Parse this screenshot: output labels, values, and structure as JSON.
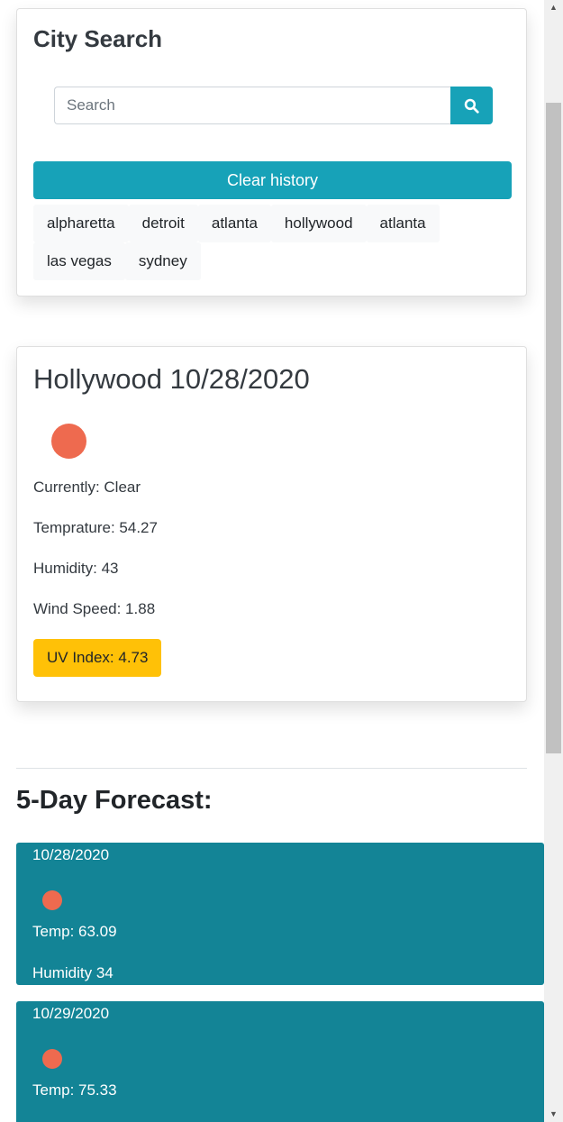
{
  "search": {
    "title": "City Search",
    "placeholder": "Search",
    "button_icon": "search-icon",
    "clear_label": "Clear history",
    "history": [
      "alpharetta",
      "detroit",
      "atlanta",
      "hollywood",
      "atlanta",
      "las vegas",
      "sydney"
    ]
  },
  "current": {
    "title": "Hollywood 10/28/2020",
    "icon": "sun-icon",
    "currently": "Currently: Clear",
    "temperature": "Temprature: 54.27",
    "humidity": "Humidity: 43",
    "wind": "Wind Speed: 1.88",
    "uv": "UV Index: 4.73"
  },
  "forecast": {
    "heading": "5-Day Forecast:",
    "days": [
      {
        "date": "10/28/2020",
        "temp": "Temp: 63.09",
        "humidity": "Humidity 34",
        "icon": "sun-icon"
      },
      {
        "date": "10/29/2020",
        "temp": "Temp: 75.33",
        "humidity": "",
        "icon": "sun-icon"
      }
    ]
  },
  "colors": {
    "accent": "#17a2b8",
    "forecast_bg": "#138496",
    "uv_badge": "#ffc107",
    "sun": "#ee6a4f"
  }
}
